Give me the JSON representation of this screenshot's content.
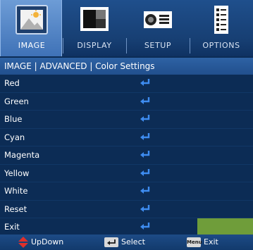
{
  "tabs": [
    {
      "label": "IMAGE",
      "icon": "image-landscape-icon",
      "active": true
    },
    {
      "label": "DISPLAY",
      "icon": "display-icon",
      "active": false
    },
    {
      "label": "SETUP",
      "icon": "projector-setup-icon",
      "active": false
    },
    {
      "label": "OPTIONS",
      "icon": "options-checklist-icon",
      "active": false
    }
  ],
  "breadcrumb": "IMAGE | ADVANCED | Color Settings",
  "menu_items": [
    {
      "label": "Red",
      "icon": "enter-icon"
    },
    {
      "label": "Green",
      "icon": "enter-icon"
    },
    {
      "label": "Blue",
      "icon": "enter-icon"
    },
    {
      "label": "Cyan",
      "icon": "enter-icon"
    },
    {
      "label": "Magenta",
      "icon": "enter-icon"
    },
    {
      "label": "Yellow",
      "icon": "enter-icon"
    },
    {
      "label": "White",
      "icon": "enter-icon"
    },
    {
      "label": "Reset",
      "icon": "enter-icon"
    },
    {
      "label": "Exit",
      "icon": "enter-icon",
      "highlighted": true
    }
  ],
  "footer": {
    "updown_label": "UpDown",
    "select_label": "Select",
    "menu_key": "Menu",
    "exit_label": "Exit"
  },
  "colors": {
    "background": "#0c2c55",
    "active_tab": "#5b8bc9",
    "enter_arrow": "#3e8cf0",
    "highlight": "#6f9d3a",
    "updown_arrow": "#e0302b"
  }
}
